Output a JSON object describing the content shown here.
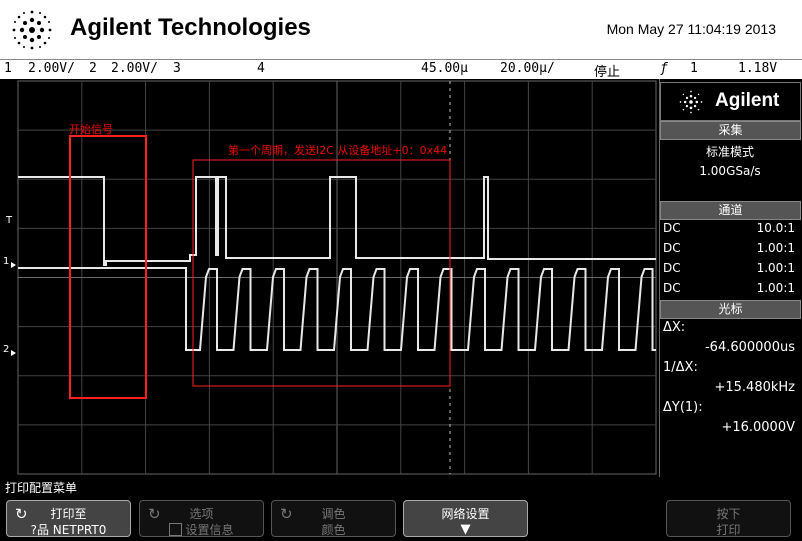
{
  "header": {
    "brand": "Agilent Technologies",
    "datetime": "Mon May 27 11:04:19 2013"
  },
  "statusbar": {
    "ch1_num": "1",
    "ch1_scale": "2.00V/",
    "ch2_num": "2",
    "ch2_scale": "2.00V/",
    "ch3_num": "3",
    "ch4_num": "4",
    "time_pos": "45.00µ",
    "time_scale": "20.00µ/",
    "run_state": "停止",
    "trig_symbol": "ƒ",
    "trig_ch": "1",
    "trig_level": "1.18V"
  },
  "markers": {
    "trig": "T",
    "ch1": "1",
    "ch2": "2"
  },
  "annotations": {
    "start_signal": "开始信号",
    "first_period": "第一个周期，发送I2C 从设备地址+0：0x44"
  },
  "side": {
    "logo": "Agilent",
    "acquire": {
      "title": "采集",
      "mode": "标准模式",
      "rate": "1.00GSa/s"
    },
    "channels": {
      "title": "通道",
      "rows": [
        {
          "coupling": "DC",
          "probe": "10.0:1"
        },
        {
          "coupling": "DC",
          "probe": "1.00:1"
        },
        {
          "coupling": "DC",
          "probe": "1.00:1"
        },
        {
          "coupling": "DC",
          "probe": "1.00:1"
        }
      ]
    },
    "cursors": {
      "title": "光标",
      "dx_label": "ΔX:",
      "dx_value": "-64.600000us",
      "inv_dx_label": "1/ΔX:",
      "inv_dx_value": "+15.480kHz",
      "dy_label": "ΔY(1):",
      "dy_value": "+16.0000V"
    }
  },
  "menu": {
    "title": "打印配置菜单",
    "softkeys": {
      "print_to_label": "打印至",
      "print_to_value": "?品 NETPRT0",
      "options_label": "选项",
      "options_value": "设置信息",
      "palette_label": "调色",
      "palette_value": "颜色",
      "network_label": "网络设置",
      "press_label": "按下",
      "press_value": "打印"
    }
  },
  "colors": {
    "background": "#000000",
    "waveform": "#e8e8e8",
    "annotation": "#ff2020",
    "header_bg": "#ffffff"
  }
}
